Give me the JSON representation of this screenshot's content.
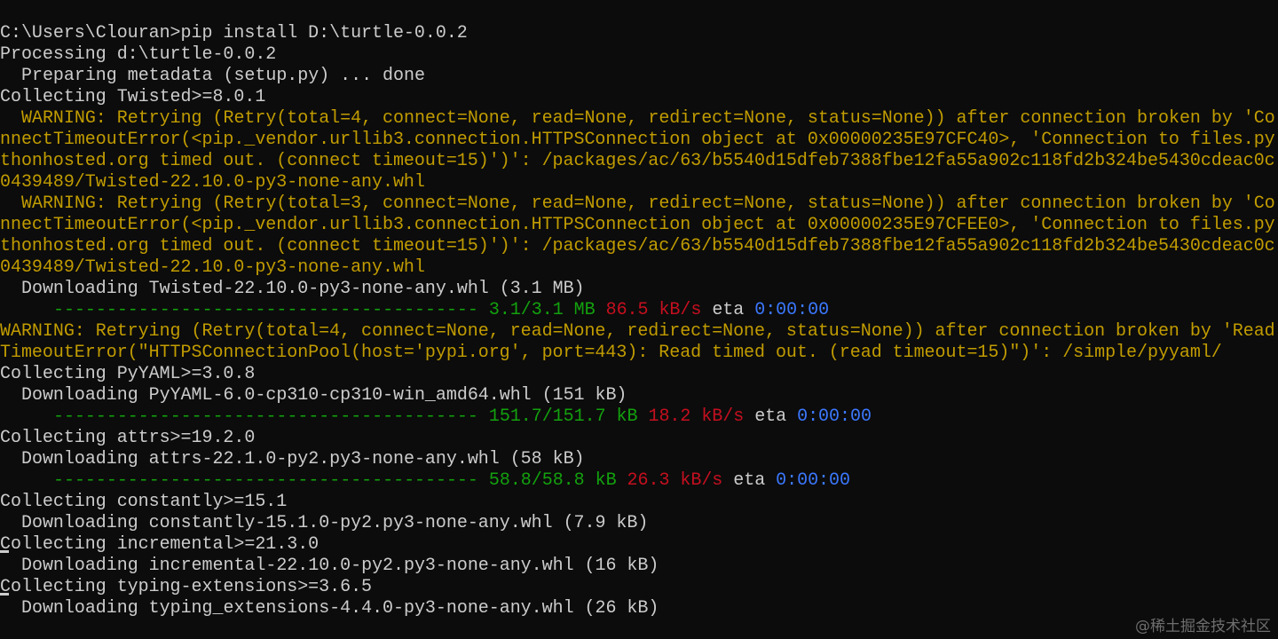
{
  "terminal": {
    "command": "C:\\Users\\Clouran>pip install D:\\turtle-0.0.2",
    "processing": "Processing d:\\turtle-0.0.2",
    "preparing": "Preparing metadata (setup.py) ... done",
    "collecting_twisted": "Collecting Twisted>=8.0.1",
    "warn1": [
      "WARNING: Retrying (Retry(total=4, connect=None, read=None, redirect=None, status=None)) after connection broken by 'Co",
      "nnectTimeoutError(<pip._vendor.urllib3.connection.HTTPSConnection object at 0x00000235E97CFC40>, 'Connection to files.py",
      "thonhosted.org timed out. (connect timeout=15)')': /packages/ac/63/b5540d15dfeb7388fbe12fa55a902c118fd2b324be5430cdeac0c",
      "0439489/Twisted-22.10.0-py3-none-any.whl"
    ],
    "warn2": [
      "WARNING: Retrying (Retry(total=3, connect=None, read=None, redirect=None, status=None)) after connection broken by 'Co",
      "nnectTimeoutError(<pip._vendor.urllib3.connection.HTTPSConnection object at 0x00000235E97CFEE0>, 'Connection to files.py",
      "thonhosted.org timed out. (connect timeout=15)')': /packages/ac/63/b5540d15dfeb7388fbe12fa55a902c118fd2b324be5430cdeac0c",
      "0439489/Twisted-22.10.0-py3-none-any.whl"
    ],
    "dl_twisted": "Downloading Twisted-22.10.0-py3-none-any.whl (3.1 MB)",
    "bar_twisted": {
      "bar": "----------------------------------------",
      "size": "3.1/3.1 MB",
      "speed": "86.5 kB/s",
      "eta_label": "eta",
      "eta": "0:00:00"
    },
    "warn3": [
      "WARNING: Retrying (Retry(total=4, connect=None, read=None, redirect=None, status=None)) after connection broken by 'Read",
      "TimeoutError(\"HTTPSConnectionPool(host='pypi.org', port=443): Read timed out. (read timeout=15)\")': /simple/pyyaml/"
    ],
    "collecting_pyyaml": "Collecting PyYAML>=3.0.8",
    "dl_pyyaml": "Downloading PyYAML-6.0-cp310-cp310-win_amd64.whl (151 kB)",
    "bar_pyyaml": {
      "bar": "----------------------------------------",
      "size": "151.7/151.7 kB",
      "speed": "18.2 kB/s",
      "eta_label": "eta",
      "eta": "0:00:00"
    },
    "collecting_attrs": "Collecting attrs>=19.2.0",
    "dl_attrs": "Downloading attrs-22.1.0-py2.py3-none-any.whl (58 kB)",
    "bar_attrs": {
      "bar": "----------------------------------------",
      "size": "58.8/58.8 kB",
      "speed": "26.3 kB/s",
      "eta_label": "eta",
      "eta": "0:00:00"
    },
    "collecting_constantly": "Collecting constantly>=15.1",
    "dl_constantly": "Downloading constantly-15.1.0-py2.py3-none-any.whl (7.9 kB)",
    "collecting_incremental": "Collecting incremental>=21.3.0",
    "dl_incremental": "Downloading incremental-22.10.0-py2.py3-none-any.whl (16 kB)",
    "collecting_typing": "Collecting typing-extensions>=3.6.5",
    "dl_typing": "Downloading typing_extensions-4.4.0-py3-none-any.whl (26 kB)"
  },
  "watermark": "@稀土掘金技术社区",
  "colors": {
    "background": "#0c0c0c",
    "text": "#cccccc",
    "warning": "#c19c00",
    "progress": "#13a10e",
    "speed": "#c50f1f",
    "eta": "#3b78ff"
  }
}
